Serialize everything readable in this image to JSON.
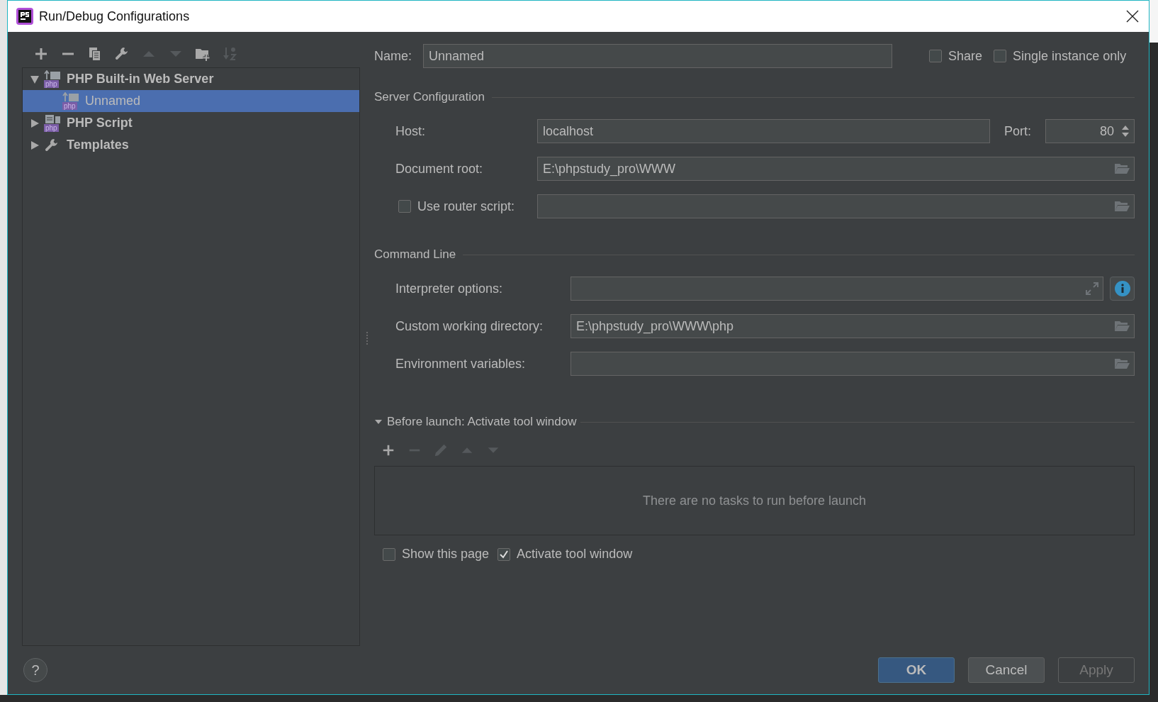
{
  "window": {
    "title": "Run/Debug Configurations"
  },
  "toolbar": [
    {
      "kind": "add",
      "disabled": false
    },
    {
      "kind": "remove",
      "disabled": false
    },
    {
      "kind": "copy",
      "disabled": false
    },
    {
      "kind": "wrench",
      "disabled": false
    },
    {
      "kind": "up",
      "disabled": true
    },
    {
      "kind": "down",
      "disabled": true
    },
    {
      "kind": "folder-add",
      "disabled": false
    },
    {
      "kind": "sort",
      "disabled": true
    }
  ],
  "tree": [
    {
      "label": "PHP Built-in Web Server",
      "kind": "server",
      "badge": "php",
      "expanded": true,
      "selected": false,
      "children": [
        {
          "label": "Unnamed",
          "kind": "server",
          "badge": "php",
          "selected": true
        }
      ]
    },
    {
      "label": "PHP Script",
      "kind": "script",
      "badge": "php",
      "expanded": false,
      "selected": false
    },
    {
      "label": "Templates",
      "kind": "wrench",
      "expanded": false,
      "selected": false
    }
  ],
  "name": {
    "label": "Name:",
    "value": "Unnamed"
  },
  "options": [
    {
      "label": "Share",
      "checked": false
    },
    {
      "label": "Single instance only",
      "checked": false
    }
  ],
  "server_configuration": {
    "title": "Server Configuration",
    "host": {
      "label": "Host:",
      "value": "localhost"
    },
    "port": {
      "label": "Port:",
      "value": "80"
    },
    "document_root": {
      "label": "Document root:",
      "value": "E:\\phpstudy_pro\\WWW"
    },
    "router_script": {
      "label": "Use router script:",
      "checked": false
    }
  },
  "command_line": {
    "title": "Command Line",
    "rows": [
      {
        "label": "Interpreter options:",
        "kind": "expand"
      },
      {
        "label": "Custom working directory:",
        "value": "E:\\phpstudy_pro\\WWW\\php",
        "kind": "browse"
      },
      {
        "label": "Environment variables:",
        "kind": "browse"
      }
    ]
  },
  "before_launch": {
    "title": "Before launch: Activate tool window",
    "expanded": true,
    "toolbar": [
      {
        "kind": "add",
        "disabled": false
      },
      {
        "kind": "remove",
        "disabled": true
      },
      {
        "kind": "edit",
        "disabled": true
      },
      {
        "kind": "up",
        "disabled": true
      },
      {
        "kind": "down",
        "disabled": true
      }
    ],
    "empty_text": "There are no tasks to run before launch",
    "options": [
      {
        "label": "Show this page",
        "checked": false
      },
      {
        "label": "Activate tool window",
        "checked": true
      }
    ]
  },
  "help": "?",
  "buttons": [
    {
      "label": "OK",
      "kind": "primary",
      "disabled": false
    },
    {
      "label": "Cancel",
      "kind": "normal",
      "disabled": false
    },
    {
      "label": "Apply",
      "kind": "normal",
      "disabled": true
    }
  ]
}
